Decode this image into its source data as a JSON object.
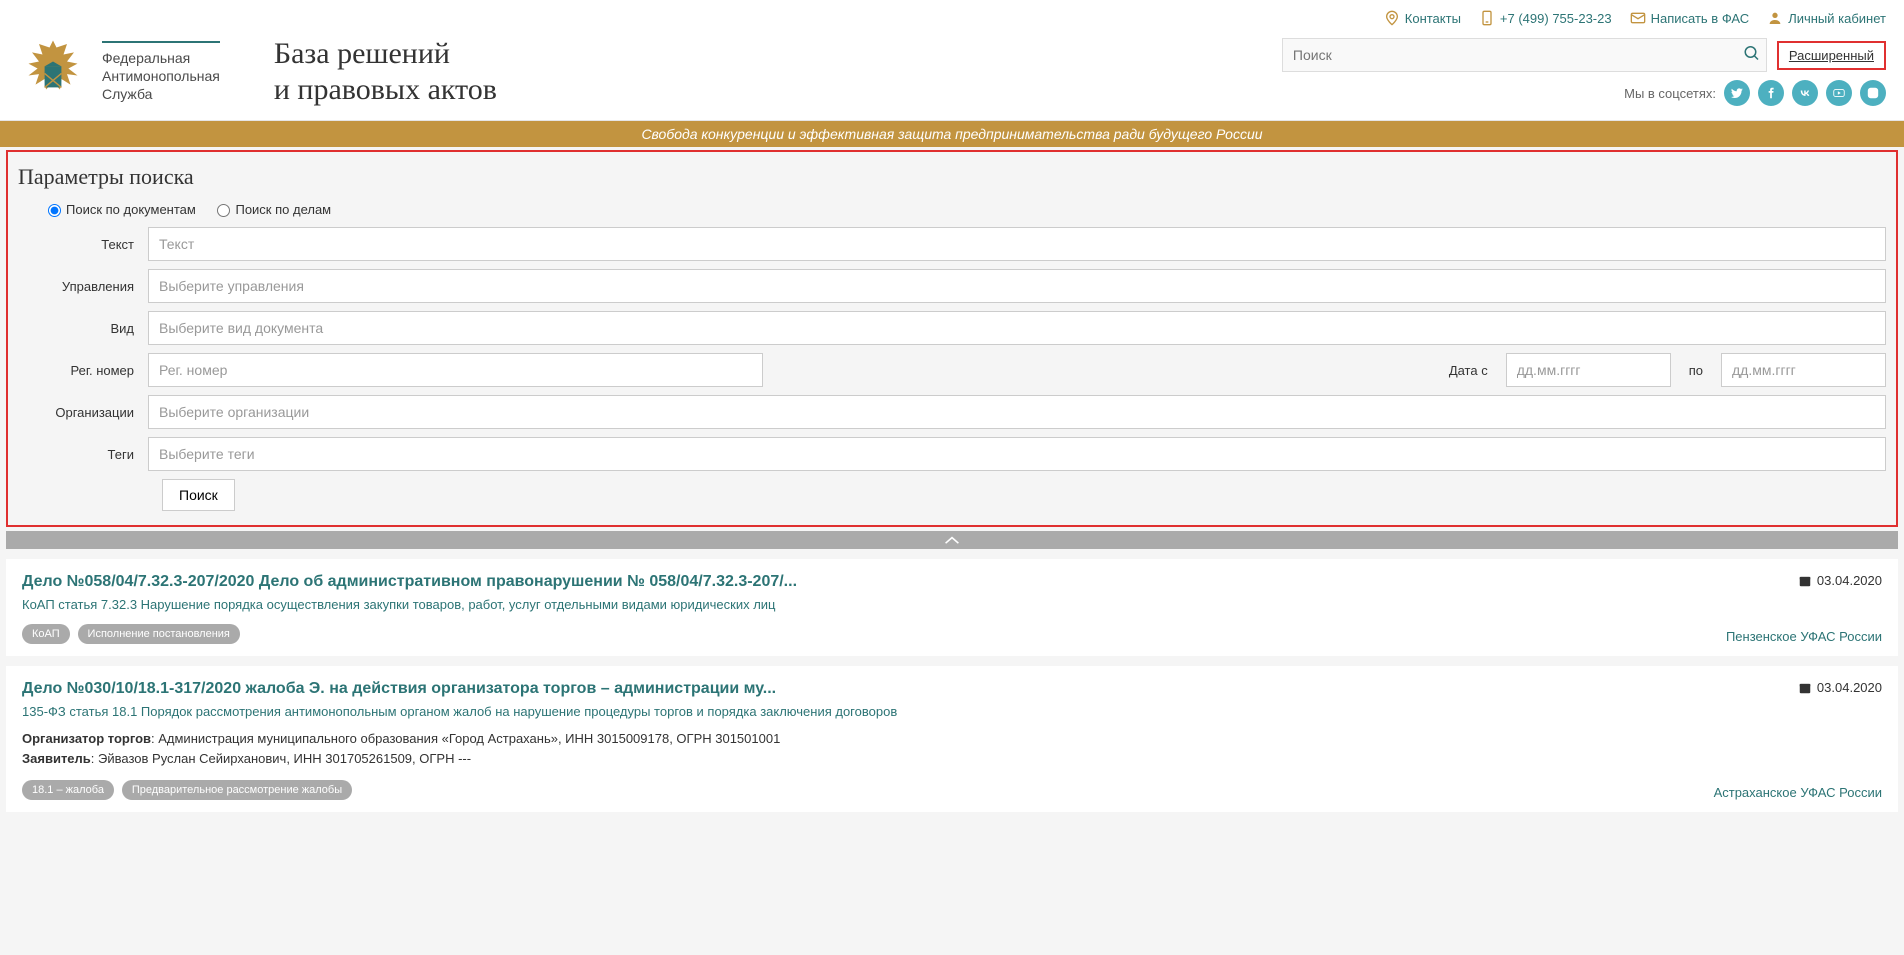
{
  "top_links": {
    "contacts": "Контакты",
    "phone": "+7 (499) 755-23-23",
    "write": "Написать в ФАС",
    "cabinet": "Личный кабинет"
  },
  "logo_lines": {
    "l1": "Федеральная",
    "l2": "Антимонопольная",
    "l3": "Служба"
  },
  "site_title": {
    "l1": "База решений",
    "l2": "и правовых актов"
  },
  "search": {
    "placeholder": "Поиск",
    "advanced": "Расширенный"
  },
  "socials_label": "Мы в соцсетях:",
  "banner": "Свобода конкуренции и эффективная защита предпринимательства ради будущего России",
  "params": {
    "title": "Параметры поиска",
    "radio_docs": "Поиск по документам",
    "radio_cases": "Поиск по делам",
    "labels": {
      "text": "Текст",
      "depts": "Управления",
      "type": "Вид",
      "reg": "Рег. номер",
      "date_from": "Дата с",
      "date_to": "по",
      "orgs": "Организации",
      "tags": "Теги"
    },
    "placeholders": {
      "text": "Текст",
      "depts": "Выберите управления",
      "type": "Выберите вид документа",
      "reg": "Рег. номер",
      "date": "дд.мм.гггг",
      "orgs": "Выберите организации",
      "tags": "Выберите теги"
    },
    "search_btn": "Поиск"
  },
  "results": {
    "0": {
      "title": "Дело №058/04/7.32.3-207/2020 Дело об административном правонарушении № 058/04/7.32.3-207/...",
      "sub": "КоАП статья 7.32.3 Нарушение порядка осуществления закупки товаров, работ, услуг отдельными видами юридических лиц",
      "date": "03.04.2020",
      "tag1": "КоАП",
      "tag2": "Исполнение постановления",
      "ufas": "Пензенское УФАС России"
    },
    "1": {
      "title": "Дело №030/10/18.1-317/2020 жалоба Э. на действия организатора торгов – администрации му...",
      "sub": "135-ФЗ статья 18.1 Порядок рассмотрения антимонопольным органом жалоб на нарушение процедуры торгов и порядка заключения договоров",
      "date": "03.04.2020",
      "org1_label": "Организатор торгов",
      "org1_val": ": Администрация муниципального образования «Город Астрахань», ИНН 3015009178, ОГРН 301501001",
      "org2_label": "Заявитель",
      "org2_val": ": Эйвазов Руслан Сейирханович, ИНН 301705261509, ОГРН ---",
      "tag1": "18.1 – жалоба",
      "tag2": "Предварительное рассмотрение жалобы",
      "ufas": "Астраханское УФАС России"
    }
  }
}
